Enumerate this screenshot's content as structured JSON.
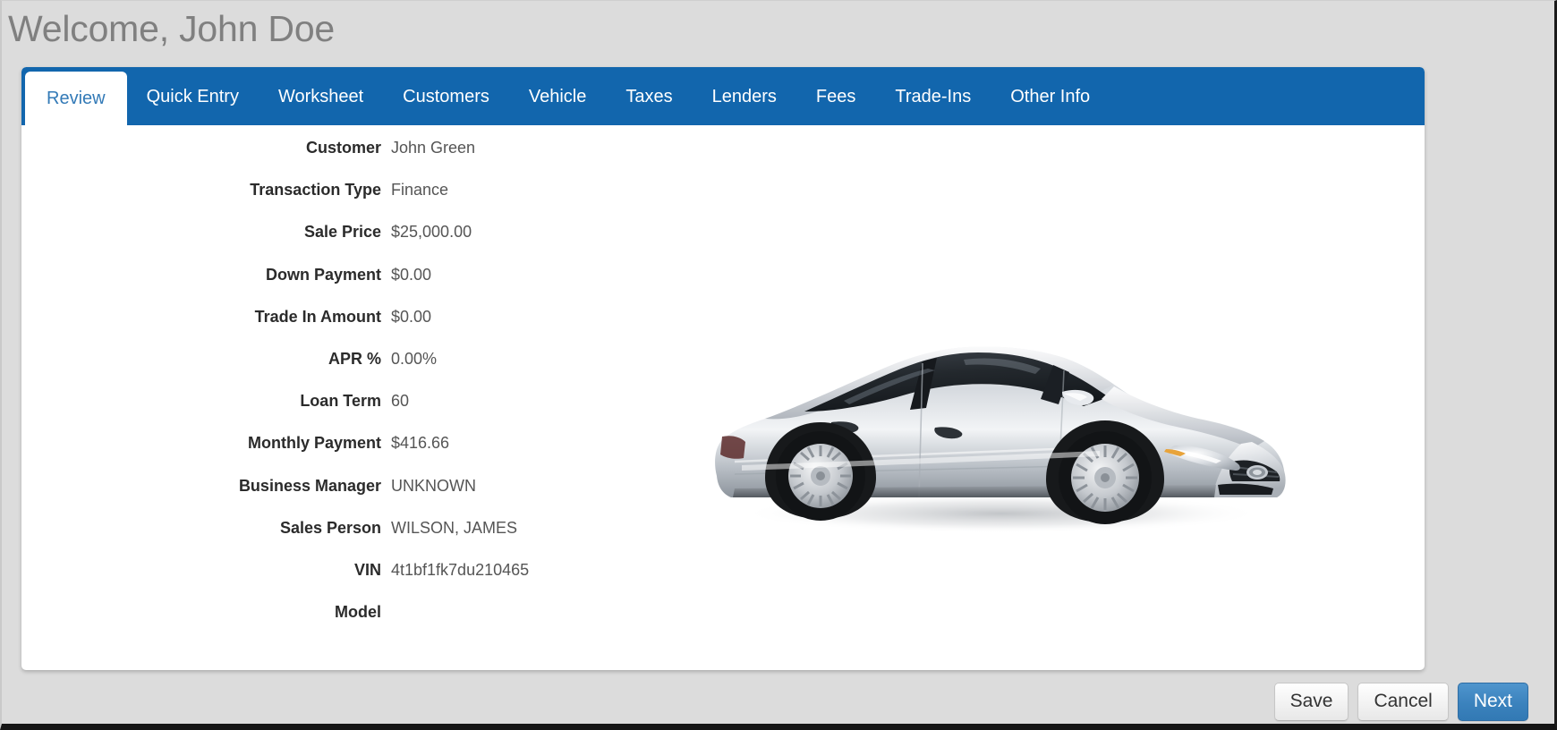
{
  "header": {
    "greeting": "Welcome, John Doe"
  },
  "tabs": [
    {
      "label": "Review",
      "active": true
    },
    {
      "label": "Quick Entry",
      "active": false
    },
    {
      "label": "Worksheet",
      "active": false
    },
    {
      "label": "Customers",
      "active": false
    },
    {
      "label": "Vehicle",
      "active": false
    },
    {
      "label": "Taxes",
      "active": false
    },
    {
      "label": "Lenders",
      "active": false
    },
    {
      "label": "Fees",
      "active": false
    },
    {
      "label": "Trade-Ins",
      "active": false
    },
    {
      "label": "Other Info",
      "active": false
    }
  ],
  "review": {
    "rows": [
      {
        "label": "Customer",
        "value": "John Green"
      },
      {
        "label": "Transaction Type",
        "value": "Finance"
      },
      {
        "label": "Sale Price",
        "value": "$25,000.00"
      },
      {
        "label": "Down Payment",
        "value": "$0.00"
      },
      {
        "label": "Trade In Amount",
        "value": "$0.00"
      },
      {
        "label": "APR %",
        "value": "0.00%"
      },
      {
        "label": "Loan Term",
        "value": "60"
      },
      {
        "label": "Monthly Payment",
        "value": "$416.66"
      },
      {
        "label": "Business Manager",
        "value": "UNKNOWN"
      },
      {
        "label": "Sales Person",
        "value": "WILSON, JAMES"
      },
      {
        "label": "VIN",
        "value": "4t1bf1fk7du210465"
      },
      {
        "label": "Model",
        "value": ""
      }
    ],
    "vehicle_image_alt": "silver-sedan-photo"
  },
  "footer": {
    "buttons": [
      {
        "label": "Save",
        "style": "default"
      },
      {
        "label": "Cancel",
        "style": "default"
      },
      {
        "label": "Next",
        "style": "primary"
      }
    ]
  },
  "colors": {
    "tab_bar_blue": "#1266ad",
    "active_tab_text": "#337ab7",
    "primary_button": "#3279b4",
    "page_background": "#dcdcdc",
    "heading_gray": "#808080"
  }
}
